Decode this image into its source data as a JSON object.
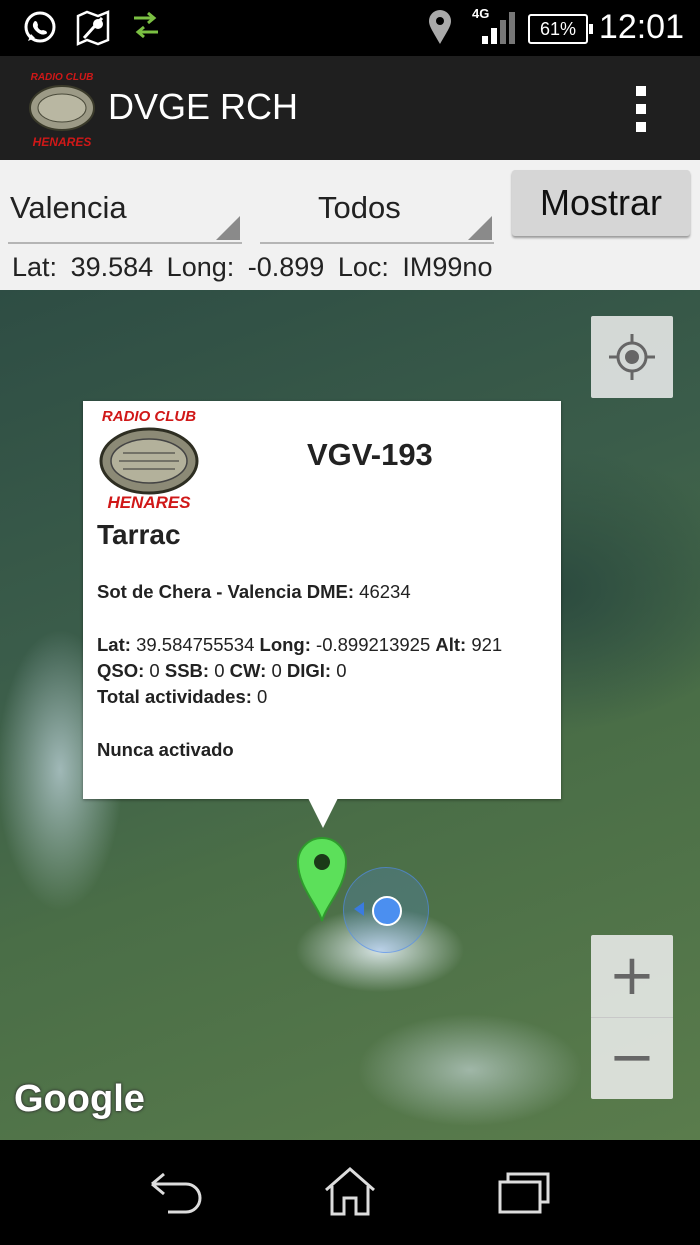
{
  "status_bar": {
    "network": "4G",
    "battery": "61%",
    "time": "12:01",
    "icons": [
      "whatsapp-icon",
      "maps-icon",
      "data-transfer-icon",
      "location-icon",
      "signal-icon",
      "battery-icon"
    ]
  },
  "action_bar": {
    "logo_top": "RADIO CLUB",
    "logo_bottom": "HENARES",
    "title": "DVGE RCH",
    "menu_icon": "overflow-menu-icon"
  },
  "filters": {
    "province": "Valencia",
    "type": "Todos",
    "show_button": "Mostrar"
  },
  "coords": {
    "lat_label": "Lat:",
    "lat": "39.584",
    "long_label": "Long:",
    "long": "-0.899",
    "loc_label": "Loc:",
    "loc": "IM99no"
  },
  "info_window": {
    "logo_top": "RADIO CLUB",
    "logo_bottom": "HENARES",
    "id": "VGV-193",
    "name": "Tarrac",
    "place": "Sot de Chera - Valencia",
    "dme_label": "DME:",
    "dme": "46234",
    "lat_label": "Lat:",
    "lat": "39.584755534",
    "long_label": "Long:",
    "long": "-0.899213925",
    "alt_label": "Alt:",
    "alt": "921",
    "qso_label": "QSO:",
    "qso": "0",
    "ssb_label": "SSB:",
    "ssb": "0",
    "cw_label": "CW:",
    "cw": "0",
    "digi_label": "DIGI:",
    "digi": "0",
    "total_label": "Total actividades:",
    "total": "0",
    "status": "Nunca activado"
  },
  "map": {
    "attribution": "Google",
    "zoom_in": "+",
    "zoom_out": "−",
    "marker_color": "#5ce05a",
    "my_location_color": "#4b8ff0"
  },
  "nav_bar": {
    "icons": [
      "back-icon",
      "home-icon",
      "recents-icon"
    ]
  }
}
